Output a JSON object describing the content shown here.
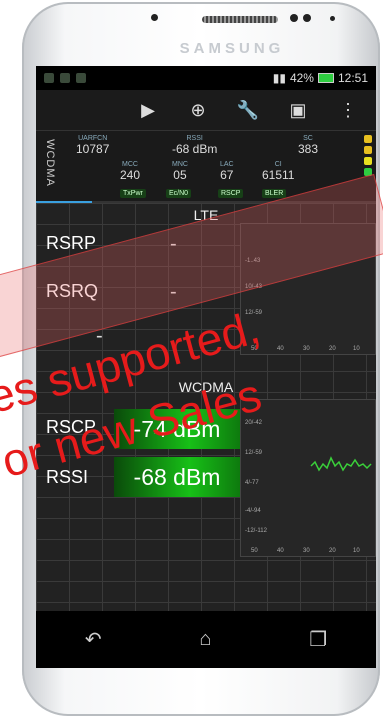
{
  "device": {
    "brand": "SAMSUNG"
  },
  "status_bar": {
    "signal": "†▇",
    "battery": "42%",
    "time": "12:51"
  },
  "toolbar": {
    "play_icon": "play-icon",
    "add_icon": "plus-circle-icon",
    "wrench_icon": "wrench-icon",
    "camera_icon": "camera-icon",
    "menu_icon": "overflow-menu-icon"
  },
  "info_panel": {
    "tech": "WCDMA",
    "uarfcn_label": "UARFCN",
    "uarfcn": "10787",
    "rssi_label": "RSSI",
    "rssi": "-68 dBm",
    "sc_label": "SC",
    "sc": "383",
    "mcc_label": "MCC",
    "mcc": "240",
    "mnc_label": "MNC",
    "mnc": "05",
    "lac_label": "LAC",
    "lac": "67",
    "ci_label": "CI",
    "ci": "61511",
    "tags": [
      "TxPwr",
      "Ec/N0",
      "RSCP",
      "BLER"
    ]
  },
  "lte": {
    "header": "LTE",
    "rsrp_label": "RSRP",
    "rsrp_value": "-",
    "rsrq_label": "RSRQ",
    "rsrq_value": "-",
    "sinr_value": "-",
    "ticks_y": [
      "-1..43",
      "10/-43",
      "12/-59"
    ],
    "ticks_x": [
      "50",
      "40",
      "30",
      "20",
      "10"
    ]
  },
  "wcdma": {
    "header": "WCDMA",
    "rscp_label": "RSCP",
    "rscp_value": "-74 dBm",
    "rssi_label": "RSSI",
    "rssi_value": "-68 dBm",
    "ticks_y": [
      "20/-42",
      "12/-59",
      "4/-77",
      "-4/-94",
      "-12/-112"
    ],
    "ticks_x": [
      "50",
      "40",
      "30",
      "20",
      "10"
    ]
  },
  "overlay": {
    "line1": "es supported,",
    "line2": "or new Sales"
  },
  "colors": {
    "accent_green": "#17c017",
    "stamp_red": "#e61b1b",
    "tab_blue": "#3aa0e0"
  }
}
